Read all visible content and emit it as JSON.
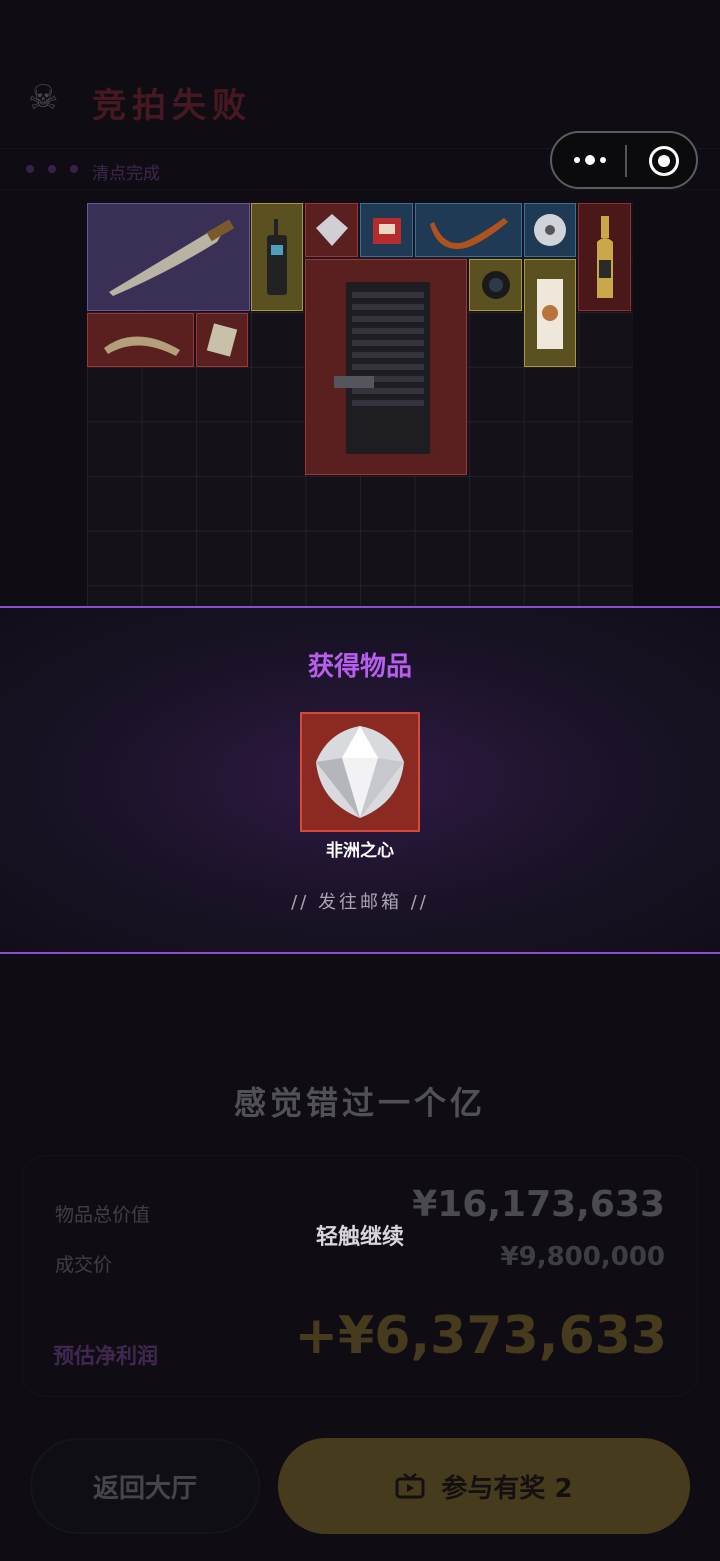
{
  "header": {
    "title": "竞拍失败",
    "subtitle": "清点完成"
  },
  "loot": {
    "title": "获得物品",
    "item_name": "非洲之心",
    "mail_label": "// 发往邮箱 //"
  },
  "result": {
    "headline": "感觉错过一个亿",
    "total_value_label": "物品总价值",
    "total_value": "¥16,173,633",
    "deal_price_label": "成交价",
    "deal_price": "¥9,800,000",
    "tap_hint": "轻触继续",
    "profit_label": "预估净利润",
    "profit_value": "+¥6,373,633"
  },
  "buttons": {
    "lobby_label": "返回大厅",
    "join_label": "参与有奖 2"
  },
  "colors": {
    "accent_purple": "#b85ff0",
    "gold": "#d8b43a",
    "fail_red": "#d63a4a"
  }
}
